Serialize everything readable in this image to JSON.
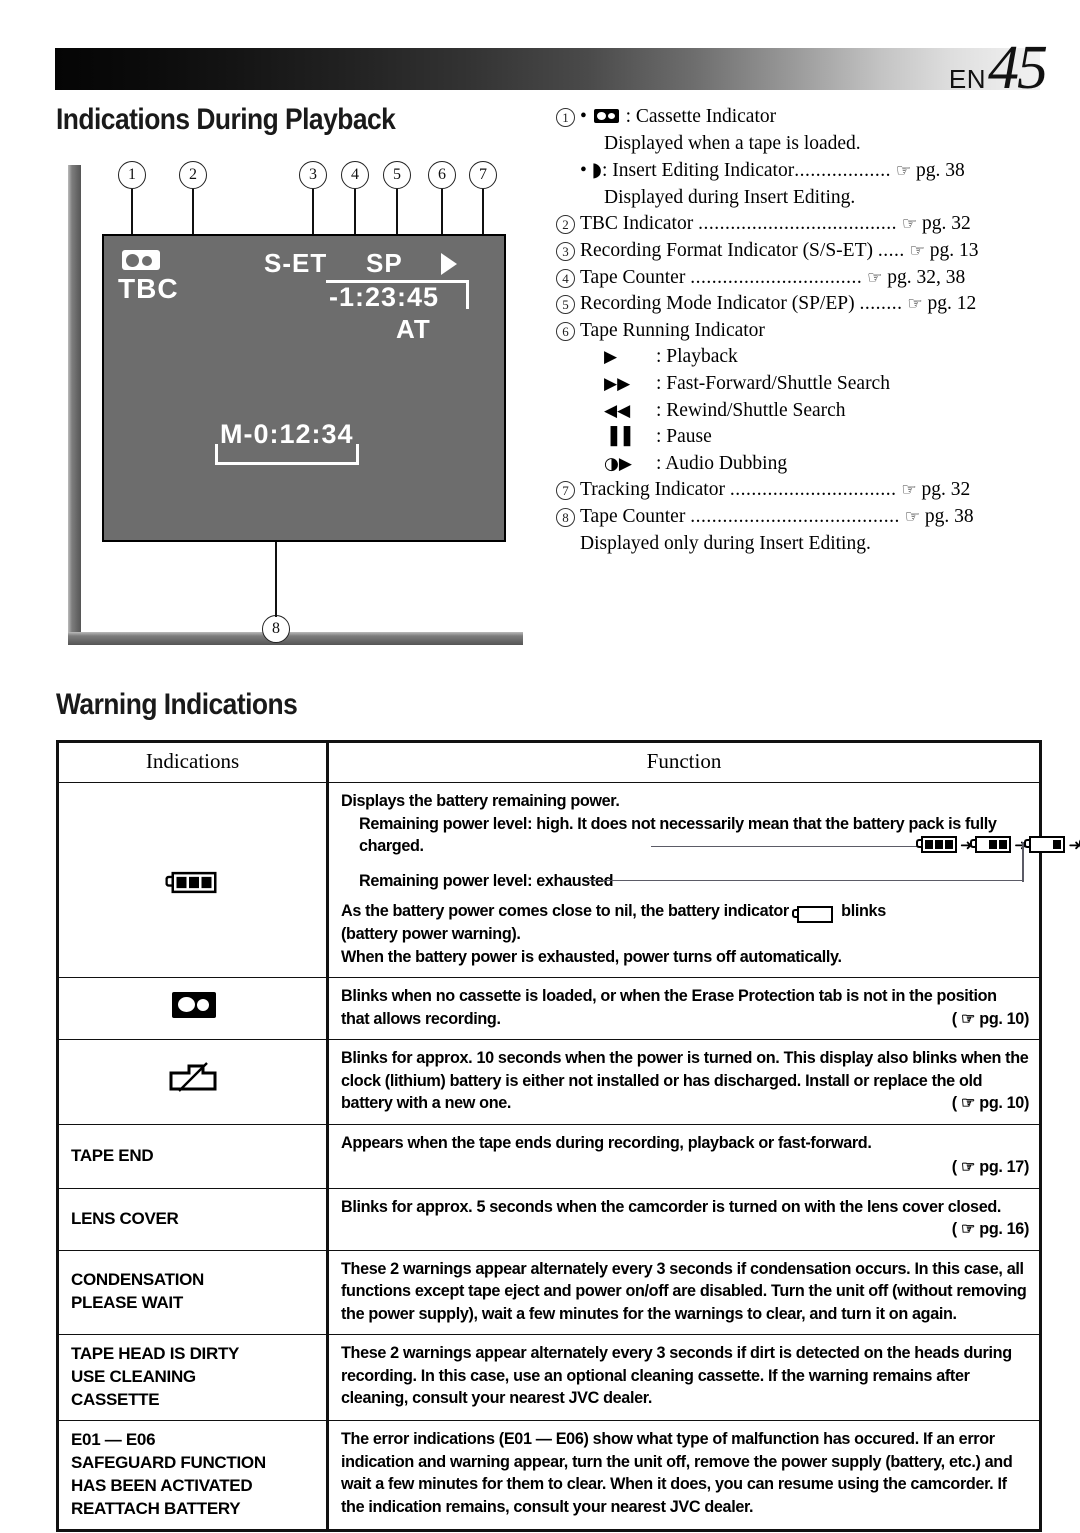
{
  "header": {
    "lang_code": "EN",
    "page_number": "45"
  },
  "sections": {
    "playback_title": "Indications During Playback",
    "warning_title": "Warning Indications"
  },
  "lcd_display": {
    "callouts": [
      "1",
      "2",
      "3",
      "4",
      "5",
      "6",
      "7",
      "8"
    ],
    "cassette_icon": "cassette-icon",
    "tbc_label": "TBC",
    "format_label": "S-ET",
    "mode_label": "SP",
    "play_icon": "play-triangle-icon",
    "counter_main": "-1:23:45",
    "tracking_label": "AT",
    "counter_insert": "M-0:12:34"
  },
  "legend": {
    "items": [
      {
        "num": "1",
        "lines": [
          {
            "bullet": true,
            "icon": "cassette-icon",
            "text": ": Cassette Indicator"
          },
          {
            "indent": 1,
            "text": "Displayed when a tape is loaded."
          },
          {
            "bullet": true,
            "icon": "insert-edit-icon",
            "text": ": Insert Editing Indicator",
            "dots": "..................",
            "page": "pg. 38"
          },
          {
            "indent": 1,
            "text": "Displayed during Insert Editing."
          }
        ]
      },
      {
        "num": "2",
        "text": "TBC Indicator",
        "dots": ".....................................",
        "page": "pg. 32"
      },
      {
        "num": "3",
        "text": "Recording Format Indicator (S/S-ET)",
        "dots": ".....",
        "page": "pg. 13"
      },
      {
        "num": "4",
        "text": "Tape Counter",
        "dots": "................................",
        "page": "pg. 32, 38"
      },
      {
        "num": "5",
        "text": "Recording Mode Indicator (SP/EP)",
        "dots": "........",
        "page": "pg. 12"
      },
      {
        "num": "6",
        "text": "Tape Running Indicator",
        "sublines": [
          {
            "sym": "▶",
            "text": ": Playback"
          },
          {
            "sym": "▶▶",
            "text": ": Fast-Forward/Shuttle Search"
          },
          {
            "sym": "◀◀",
            "text": ": Rewind/Shuttle Search"
          },
          {
            "sym": "▐▐",
            "text": ": Pause"
          },
          {
            "sym": "◑▶",
            "text": ": Audio Dubbing"
          }
        ]
      },
      {
        "num": "7",
        "text": "Tracking Indicator",
        "dots": "...............................",
        "page": "pg. 32"
      },
      {
        "num": "8",
        "text": "Tape Counter",
        "dots": ".......................................",
        "page": "pg. 38",
        "note": "Displayed only during Insert Editing."
      }
    ],
    "hand_glyph": "☞"
  },
  "warning_table": {
    "headers": [
      "Indications",
      "Function"
    ],
    "rows": [
      {
        "indication_icon": "battery-full-icon",
        "indication_text": "",
        "function_lines": [
          "Displays the battery remaining power.",
          "Remaining power level: high. It does not necessarily mean that the battery pack is fully charged.",
          "Remaining power level: exhausted",
          "As the battery power comes close to nil, the battery indicator",
          "blinks (battery power warning).",
          "When the battery power is exhausted, power turns off automatically."
        ],
        "battery_sequence": [
          "3",
          "2",
          "1",
          "0"
        ]
      },
      {
        "indication_icon": "cassette-icon",
        "indication_text": "",
        "function_text": "Blinks when no cassette is loaded, or when the Erase Protection tab is not in the position that allows recording.",
        "page": "( ☞ pg. 10)"
      },
      {
        "indication_icon": "clock-battery-icon",
        "indication_text": "",
        "function_text": "Blinks for approx. 10 seconds when the power is turned on. This display also blinks when the clock (lithium) battery is either not installed or has discharged. Install or replace the old battery with a new one.",
        "page": "( ☞ pg. 10)"
      },
      {
        "indication_text": "TAPE END",
        "function_text": "Appears when the tape ends during recording, playback or fast-forward.",
        "page": "( ☞ pg. 17)"
      },
      {
        "indication_text": "LENS COVER",
        "function_text": "Blinks for approx. 5 seconds when the camcorder is turned on with the lens cover closed.",
        "page": "( ☞ pg. 16)"
      },
      {
        "indication_text": "CONDENSATION\nPLEASE WAIT",
        "function_text": "These 2 warnings appear alternately every 3 seconds if condensation occurs. In this case, all functions except tape eject and power on/off are disabled. Turn the unit off (without removing the power supply), wait a few minutes for the warnings to clear, and turn it on again.",
        "page": ""
      },
      {
        "indication_text": "TAPE HEAD IS DIRTY\nUSE CLEANING\n  CASSETTE",
        "function_text": "These 2 warnings appear alternately every 3 seconds if dirt is detected on the heads during recording. In this case, use an optional cleaning cassette. If the warning remains after cleaning, consult your nearest JVC dealer.",
        "page": ""
      },
      {
        "indication_text": "E01 — E06\nSAFEGUARD FUNCTION\nHAS BEEN ACTIVATED\nREATTACH BATTERY",
        "function_text": "The error indications (E01 — E06) show what type of malfunction has occured. If an error indication and warning appear, turn the unit off, remove the power supply (battery, etc.) and wait a few minutes for them to clear. When it does, you can resume using the camcorder. If the indication remains, consult your nearest JVC dealer.",
        "page": ""
      }
    ]
  },
  "colors": {
    "screen_bg": "#6d6d6d",
    "ink": "#111111",
    "rule": "#5b5b66"
  }
}
